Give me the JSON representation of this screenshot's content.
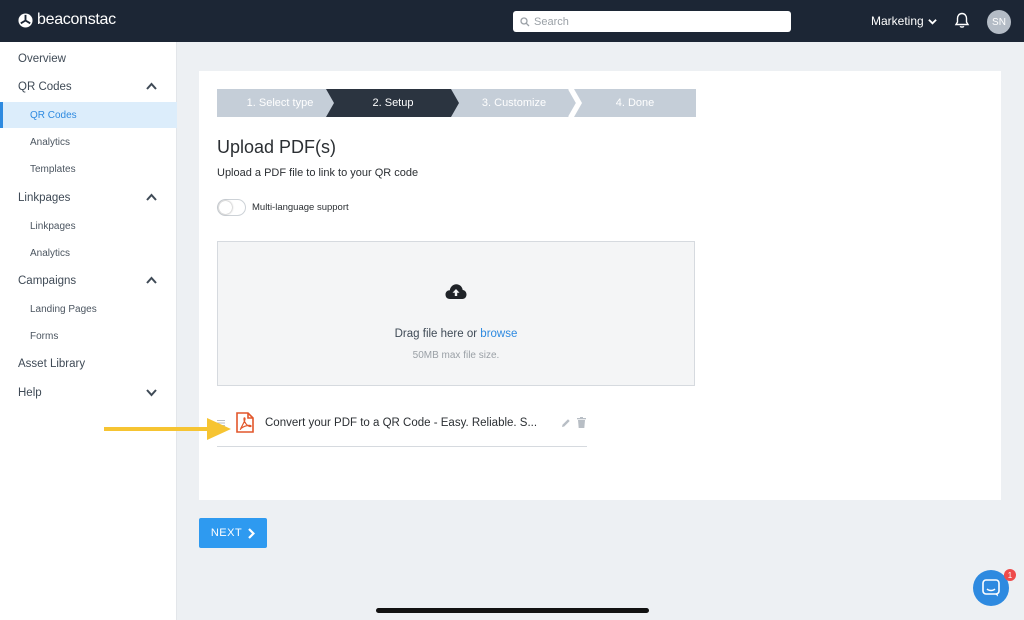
{
  "app": {
    "brand": "beaconstac",
    "search_placeholder": "Search",
    "org_menu": "Marketing",
    "avatar_initials": "SN"
  },
  "sidebar": {
    "overview": "Overview",
    "qr_codes": {
      "label": "QR Codes",
      "items": [
        "QR Codes",
        "Analytics",
        "Templates"
      ],
      "active_item": "QR Codes"
    },
    "linkpages": {
      "label": "Linkpages",
      "items": [
        "Linkpages",
        "Analytics"
      ]
    },
    "campaigns": {
      "label": "Campaigns",
      "items": [
        "Landing Pages",
        "Forms"
      ]
    },
    "asset_library": "Asset Library",
    "help": "Help"
  },
  "steps": [
    {
      "label": "1. Select type",
      "state": "done"
    },
    {
      "label": "2. Setup",
      "state": "current"
    },
    {
      "label": "3. Customize",
      "state": "upcoming"
    },
    {
      "label": "4. Done",
      "state": "upcoming"
    }
  ],
  "upload": {
    "title": "Upload PDF(s)",
    "subtitle": "Upload a PDF file to link to your QR code",
    "toggle_label": "Multi-language support",
    "toggle_on": false,
    "drop_text": "Drag file here or",
    "browse_link": "browse",
    "max_size": "50MB max file size.",
    "file_name": "Convert your PDF to a QR Code - Easy. Reliable. S..."
  },
  "next_button": "NEXT",
  "chat_badge_count": "1",
  "colors": {
    "topbar": "#1c2635",
    "accent": "#2e9af0",
    "step_current": "#2b3440",
    "step_inactive": "#c5ced8",
    "pdf_icon": "#e2572b",
    "annotation_arrow": "#f6c432"
  },
  "icons": [
    "logo-icon",
    "search-icon",
    "chevron-down-icon",
    "bell-icon",
    "chevron-up-icon",
    "cloud-upload-icon",
    "pdf-file-icon",
    "drag-handle-icon",
    "pencil-icon",
    "trash-icon",
    "arrow-annotation-icon",
    "chevron-right-icon",
    "chat-icon"
  ]
}
